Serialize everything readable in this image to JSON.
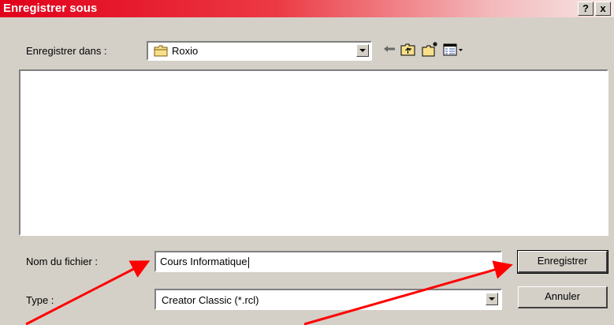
{
  "dialog": {
    "title": "Enregistrer sous",
    "help_label": "?",
    "close_label": "x"
  },
  "save_in": {
    "label": "Enregistrer dans :",
    "value": "Roxio"
  },
  "toolbar": {
    "icons": [
      "back-arrow-icon",
      "up-folder-icon",
      "new-folder-icon",
      "view-menu-icon"
    ]
  },
  "file_name": {
    "label": "Nom du fichier :",
    "value": "Cours Informatique"
  },
  "file_type": {
    "label": "Type :",
    "value": "Creator Classic (*.rcl)"
  },
  "buttons": {
    "save": "Enregistrer",
    "cancel": "Annuler"
  },
  "annotations": {
    "arrow_color": "#ff0000",
    "count": 2
  },
  "colors": {
    "titlebar_start": "#e1001a",
    "dialog_bg": "#d4d0c8"
  }
}
